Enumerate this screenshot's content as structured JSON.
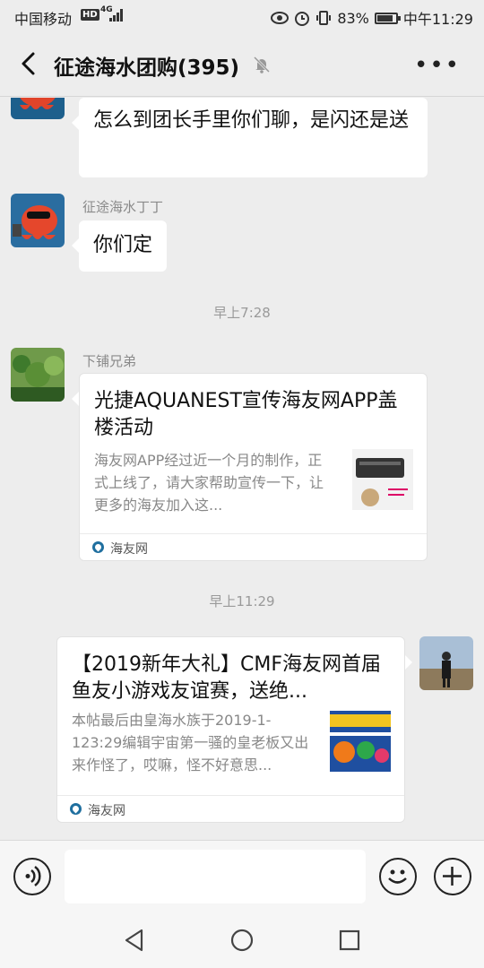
{
  "status_bar": {
    "carrier": "中国移动",
    "hd": "HD",
    "network": "4G",
    "battery": "83%",
    "battery_level": 0.83,
    "time": "中午11:29"
  },
  "header": {
    "title": "征途海水团购(395)"
  },
  "messages": {
    "m1_text": "怎么到团长手里你们聊，是闪还是送",
    "m2_sender": "征途海水丁丁",
    "m2_text": "你们定",
    "ts1": "早上7:28",
    "m3_sender": "下铺兄弟",
    "m3_card_title": "光捷AQUANEST宣传海友网APP盖楼活动",
    "m3_card_desc": "海友网APP经过近一个月的制作，正式上线了，请大家帮助宣传一下，让更多的海友加入这...",
    "m3_card_source": "海友网",
    "ts2": "早上11:29",
    "m4_card_title": "【2019新年大礼】CMF海友网首届鱼友小游戏友谊赛，送绝...",
    "m4_card_desc": "本帖最后由皇海水族于2019-1-123:29编辑宇宙第一骚的皇老板又出来作怪了，哎嘛，怪不好意思...",
    "m4_card_source": "海友网"
  },
  "input": {
    "value": ""
  },
  "colors": {
    "background": "#ededed",
    "bubble": "#ffffff",
    "source_icon": "#1f6f9f"
  }
}
